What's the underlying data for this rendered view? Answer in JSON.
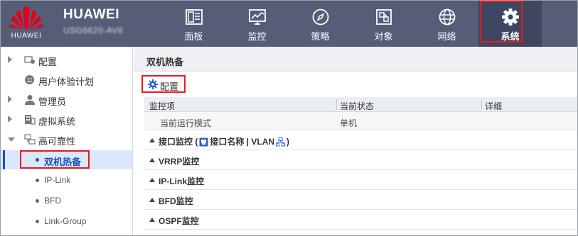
{
  "brand": {
    "logo_text": "HUAWEI",
    "title": "HUAWEI",
    "device_name": "USG6620-AV8"
  },
  "nav": {
    "items": [
      {
        "label": "面板",
        "icon": "dashboard-icon"
      },
      {
        "label": "监控",
        "icon": "monitor-chart-icon"
      },
      {
        "label": "策略",
        "icon": "compass-icon"
      },
      {
        "label": "对象",
        "icon": "object-icon"
      },
      {
        "label": "网络",
        "icon": "globe-icon"
      },
      {
        "label": "系统",
        "icon": "gear-icon",
        "active": true
      }
    ]
  },
  "sidebar": {
    "items": [
      {
        "label": "配置",
        "icon": "config-icon",
        "expandable": true
      },
      {
        "label": "用户体验计划",
        "icon": "smiley-icon"
      },
      {
        "label": "管理员",
        "icon": "admin-user-icon",
        "expandable": true
      },
      {
        "label": "虚拟系统",
        "icon": "virtual-system-icon",
        "expandable": true
      },
      {
        "label": "高可靠性",
        "icon": "high-availability-icon",
        "expanded": true
      }
    ],
    "subitems": [
      {
        "label": "双机热备",
        "selected": true
      },
      {
        "label": "IP-Link"
      },
      {
        "label": "BFD"
      },
      {
        "label": "Link-Group"
      }
    ]
  },
  "main": {
    "title": "双机热备",
    "config_button": "配置",
    "table": {
      "headers": [
        "监控项",
        "当前状态",
        "详细"
      ],
      "rows": [
        {
          "item": "当前运行模式",
          "status": "单机",
          "detail": ""
        }
      ],
      "groups": [
        {
          "label_prefix": "接口监控 (",
          "label_mid": "接口名称 | VLAN",
          "label_suffix": ")"
        },
        {
          "label": "VRRP监控"
        },
        {
          "label": "IP-Link监控"
        },
        {
          "label": "BFD监控"
        },
        {
          "label": "OSPF监控"
        }
      ]
    }
  },
  "colors": {
    "header_bg": "#565d76",
    "highlight_red": "#e81b1b",
    "selected_blue": "#1a4fb8",
    "logo_red": "#e4001b"
  }
}
